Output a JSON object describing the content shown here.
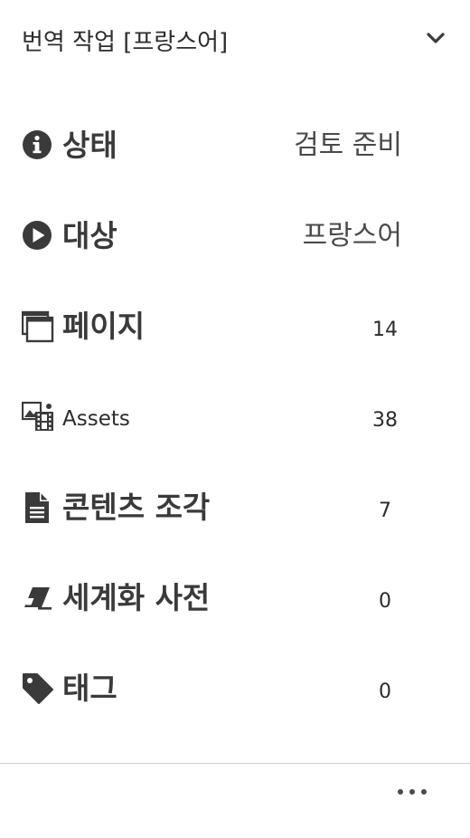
{
  "header": {
    "title": "번역 작업 [프랑스어]",
    "collapse_icon": "chevron-down-icon"
  },
  "rows": [
    {
      "icon": "info-icon",
      "label": "상태",
      "value": "검토 준비"
    },
    {
      "icon": "play-icon",
      "label": "대상",
      "value": "프랑스어"
    },
    {
      "icon": "pages-icon",
      "label": "페이지",
      "value": "14"
    },
    {
      "icon": "assets-icon",
      "label": "Assets",
      "value": "38"
    },
    {
      "icon": "document-icon",
      "label": "콘텐츠 조각",
      "value": "7"
    },
    {
      "icon": "eraser-icon",
      "label": "세계화 사전",
      "value": "0"
    },
    {
      "icon": "tag-icon",
      "label": "태그",
      "value": "0"
    }
  ],
  "footer": {
    "more_icon": "more-horizontal-icon"
  },
  "colors": {
    "text": "#2c2c2c",
    "icon": "#3a3a3a",
    "divider": "#cfcfcf"
  }
}
